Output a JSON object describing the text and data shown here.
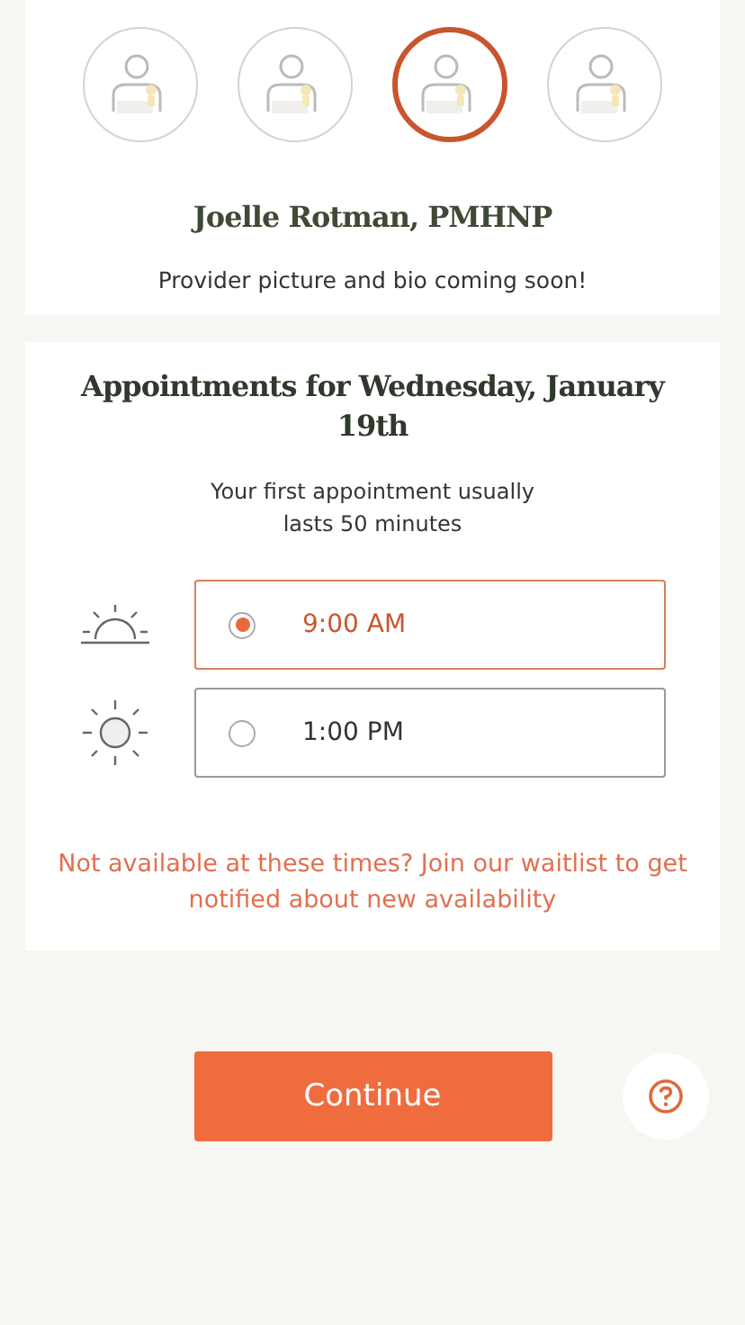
{
  "providers": [
    {
      "selected": false
    },
    {
      "selected": false
    },
    {
      "selected": true
    },
    {
      "selected": false
    }
  ],
  "provider_name": "Joelle Rotman, PMHNP",
  "provider_note": "Provider picture and bio coming soon!",
  "appointments": {
    "title": "Appointments for Wednesday, January 19th",
    "subtitle_lines": [
      "Your first appointment usually",
      "lasts 50 minutes"
    ],
    "slots": [
      {
        "kind": "sunrise",
        "time": "9:00 AM",
        "selected": true
      },
      {
        "kind": "sun",
        "time": "1:00 PM",
        "selected": false
      }
    ],
    "waitlist_link": "Not available at these times? Join our waitlist to get notified about new availability"
  },
  "continue_button": "Continue"
}
